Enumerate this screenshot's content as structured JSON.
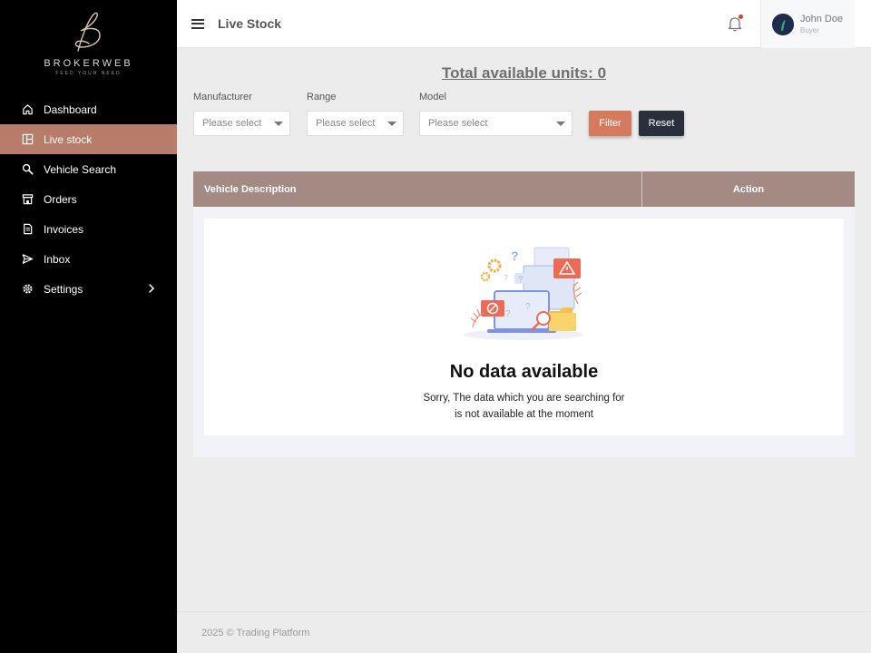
{
  "brand": {
    "name": "BROKERWEB",
    "tagline": "FEED YOUR NEED"
  },
  "sidebar": {
    "items": [
      {
        "label": "Dashboard",
        "icon": "home-icon",
        "active": false
      },
      {
        "label": "Live stock",
        "icon": "layout-icon",
        "active": true
      },
      {
        "label": "Vehicle Search",
        "icon": "search-icon",
        "active": false
      },
      {
        "label": "Orders",
        "icon": "store-icon",
        "active": false
      },
      {
        "label": "Invoices",
        "icon": "invoice-icon",
        "active": false
      },
      {
        "label": "Inbox",
        "icon": "send-icon",
        "active": false
      },
      {
        "label": "Settings",
        "icon": "gear-icon",
        "active": false,
        "has_submenu": true
      }
    ]
  },
  "header": {
    "title": "Live Stock",
    "user": {
      "name": "John Doe",
      "role": "Buyer"
    }
  },
  "main": {
    "total_units": "Total available units: 0",
    "filters": {
      "manufacturer": {
        "label": "Manufacturer",
        "value": "Please select"
      },
      "range": {
        "label": "Range",
        "value": "Please select"
      },
      "model": {
        "label": "Model",
        "value": "Please select"
      }
    },
    "buttons": {
      "filter": "Filter",
      "reset": "Reset"
    },
    "table": {
      "columns": [
        "Vehicle Description",
        "Action"
      ]
    },
    "empty": {
      "title": "No data available",
      "line1": "Sorry, The data which you are searching for",
      "line2": "is not available at the moment"
    }
  },
  "footer": {
    "text": "2025 © Trading Platform"
  },
  "colors": {
    "sidebar_bg": "#000000",
    "active_item": "#b77c6a",
    "filter_button": "#d57a5c",
    "reset_button": "#2a2f3b",
    "table_header": "#a38a83",
    "notification_dot": "#e03b2f"
  }
}
